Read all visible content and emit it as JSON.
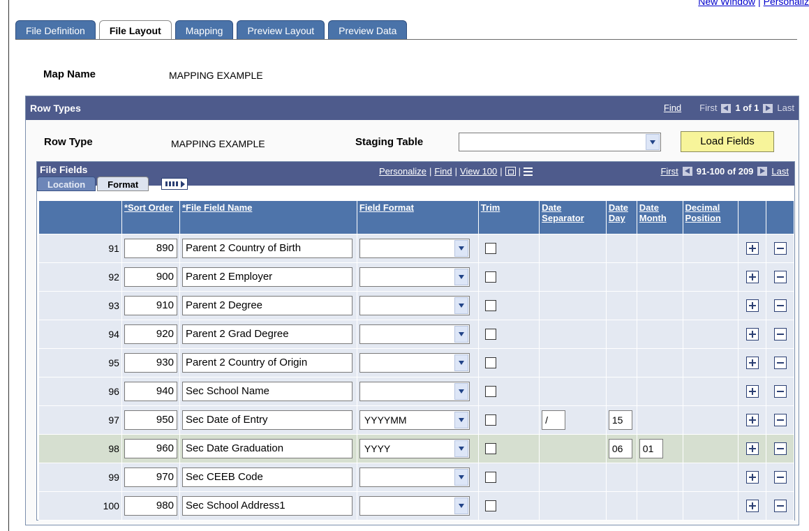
{
  "top_links": {
    "new_window": "New Window",
    "separator": "|",
    "personalize": "Personaliz"
  },
  "tabs": [
    {
      "label": "File Definition",
      "active": false
    },
    {
      "label": "File Layout",
      "active": true
    },
    {
      "label": "Mapping",
      "active": false
    },
    {
      "label": "Preview Layout",
      "active": false
    },
    {
      "label": "Preview Data",
      "active": false
    }
  ],
  "map_name": {
    "label": "Map Name",
    "value": "MAPPING EXAMPLE"
  },
  "row_types": {
    "title": "Row Types",
    "find": "Find",
    "first": "First",
    "range": "1 of 1",
    "last": "Last",
    "row_type_label": "Row Type",
    "row_type_value": "MAPPING EXAMPLE",
    "staging_table_label": "Staging Table",
    "staging_table_value": "",
    "load_fields": "Load Fields"
  },
  "file_fields": {
    "title": "File Fields",
    "personalize": "Personalize",
    "find": "Find",
    "view": "View 100",
    "first": "First",
    "range": "91-100 of 209",
    "last": "Last",
    "subtabs": [
      {
        "label": "Location",
        "active": false
      },
      {
        "label": "Format",
        "active": true
      }
    ],
    "columns": {
      "sort_order": "*Sort Order",
      "field_name": "*File Field Name",
      "field_format": "Field Format",
      "trim": "Trim",
      "date_separator": "Date Separator",
      "date_day": "Date Day",
      "date_month": "Date Month",
      "decimal_position": "Decimal Position"
    },
    "rows": [
      {
        "num": "91",
        "sort": "890",
        "name": "Parent 2 Country of Birth",
        "format": "",
        "sep": null,
        "day": null,
        "month": null
      },
      {
        "num": "92",
        "sort": "900",
        "name": "Parent 2 Employer",
        "format": "",
        "sep": null,
        "day": null,
        "month": null
      },
      {
        "num": "93",
        "sort": "910",
        "name": "Parent 2 Degree",
        "format": "",
        "sep": null,
        "day": null,
        "month": null
      },
      {
        "num": "94",
        "sort": "920",
        "name": "Parent 2 Grad Degree",
        "format": "",
        "sep": null,
        "day": null,
        "month": null
      },
      {
        "num": "95",
        "sort": "930",
        "name": "Parent 2 Country of Origin",
        "format": "",
        "sep": null,
        "day": null,
        "month": null
      },
      {
        "num": "96",
        "sort": "940",
        "name": "Sec School Name",
        "format": "",
        "sep": null,
        "day": null,
        "month": null
      },
      {
        "num": "97",
        "sort": "950",
        "name": "Sec Date of Entry",
        "format": "YYYYMM",
        "sep": "/",
        "day": "15",
        "month": null
      },
      {
        "num": "98",
        "sort": "960",
        "name": "Sec Date Graduation",
        "format": "YYYY",
        "sep": null,
        "day": "06",
        "month": "01"
      },
      {
        "num": "99",
        "sort": "970",
        "name": "Sec CEEB Code",
        "format": "",
        "sep": null,
        "day": null,
        "month": null
      },
      {
        "num": "100",
        "sort": "980",
        "name": "Sec School Address1",
        "format": "",
        "sep": null,
        "day": null,
        "month": null
      }
    ]
  }
}
